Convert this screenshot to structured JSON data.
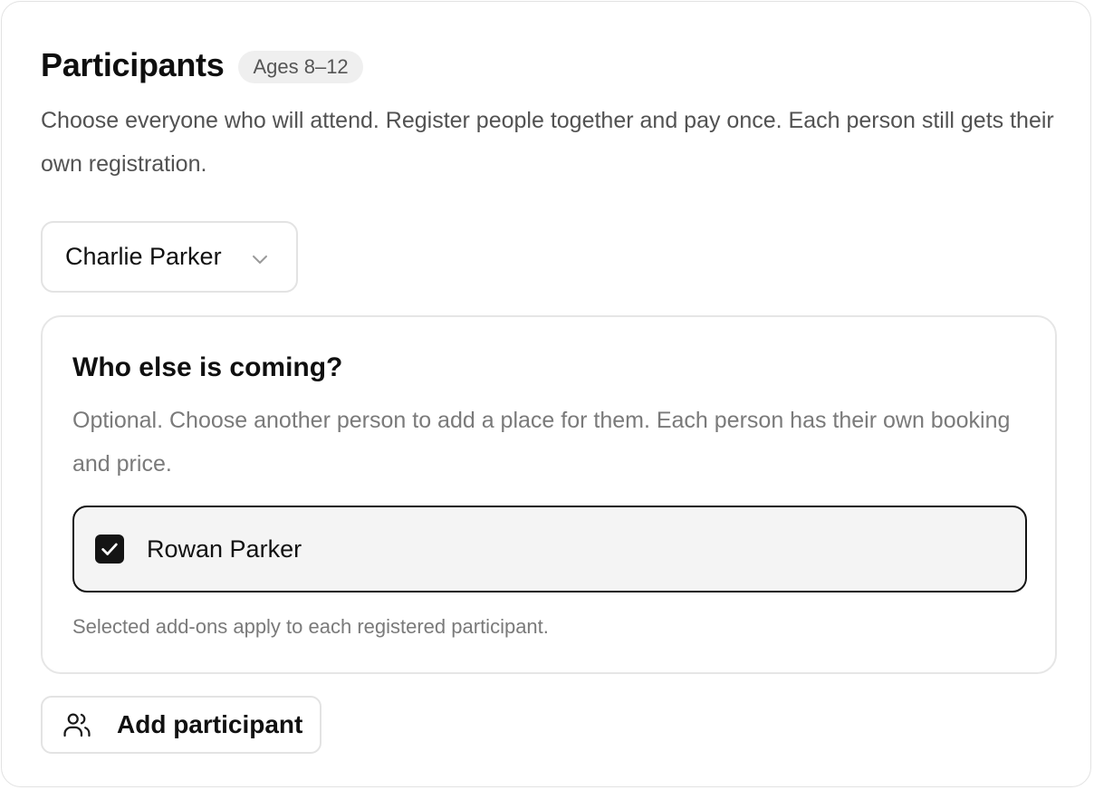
{
  "header": {
    "title": "Participants",
    "age_badge": "Ages 8–12"
  },
  "description": "Choose everyone who will attend. Register people together and pay once. Each person still gets their own registration.",
  "participant_select": {
    "selected": "Charlie Parker",
    "icon": "chevron-down-icon"
  },
  "others_panel": {
    "title": "Who else is coming?",
    "description": "Optional. Choose another person to add a place for them. Each person has their own booking and price.",
    "people": [
      {
        "name": "Rowan Parker",
        "checked": true
      }
    ],
    "note": "Selected add-ons apply to each registered participant."
  },
  "add_participant": {
    "label": "Add participant",
    "icon": "users-icon"
  },
  "colors": {
    "text": "#111111",
    "muted": "#7a7a7a",
    "border": "#e3e3e3",
    "selected_border": "#141414",
    "selected_bg": "#f4f4f4",
    "badge_bg": "#efefef"
  }
}
